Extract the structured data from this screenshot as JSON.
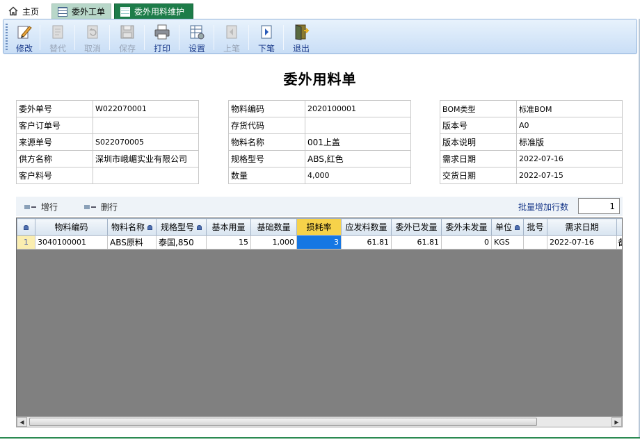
{
  "tabs": [
    {
      "label": "主页",
      "icon": "home-icon"
    },
    {
      "label": "委外工单",
      "icon": "grid-icon"
    },
    {
      "label": "委外用料维护",
      "icon": "grid-icon"
    }
  ],
  "toolbar": {
    "edit": "修改",
    "replace": "替代",
    "cancel": "取消",
    "save": "保存",
    "print": "打印",
    "settings": "设置",
    "prev": "上笔",
    "next": "下笔",
    "exit": "退出"
  },
  "title": "委外用料单",
  "form_left": [
    {
      "label": "委外单号",
      "value": "W022070001"
    },
    {
      "label": "客户订单号",
      "value": ""
    },
    {
      "label": "来源单号",
      "value": "S022070005"
    },
    {
      "label": "供方名称",
      "value": "深圳市峨嵋实业有限公司"
    },
    {
      "label": "客户料号",
      "value": ""
    }
  ],
  "form_mid": [
    {
      "label": "物料编码",
      "value": "2020100001"
    },
    {
      "label": "存货代码",
      "value": ""
    },
    {
      "label": "物料名称",
      "value": "001上盖"
    },
    {
      "label": "规格型号",
      "value": "ABS,红色"
    },
    {
      "label": "数量",
      "value": "4,000"
    }
  ],
  "form_right": [
    {
      "label": "BOM类型",
      "value": "标准BOM"
    },
    {
      "label": "版本号",
      "value": "A0"
    },
    {
      "label": "版本说明",
      "value": "标准版"
    },
    {
      "label": "需求日期",
      "value": "2022-07-16"
    },
    {
      "label": "交货日期",
      "value": "2022-07-15"
    }
  ],
  "grid_toolbar": {
    "add_row": "增行",
    "delete_row": "删行",
    "batch_label": "批量增加行数",
    "batch_value": "1"
  },
  "grid": {
    "columns": [
      "物料编码",
      "物料名称",
      "规格型号",
      "基本用量",
      "基础数量",
      "损耗率",
      "应发料数量",
      "委外已发量",
      "委外未发量",
      "单位",
      "批号",
      "需求日期",
      ""
    ],
    "rows": [
      {
        "rownum": "1",
        "cells": [
          "3040100001",
          "ABS原料",
          "泰国,850",
          "15",
          "1,000",
          "3",
          "61.81",
          "61.81",
          "0",
          "KGS",
          "",
          "2022-07-16",
          "备"
        ]
      }
    ]
  }
}
